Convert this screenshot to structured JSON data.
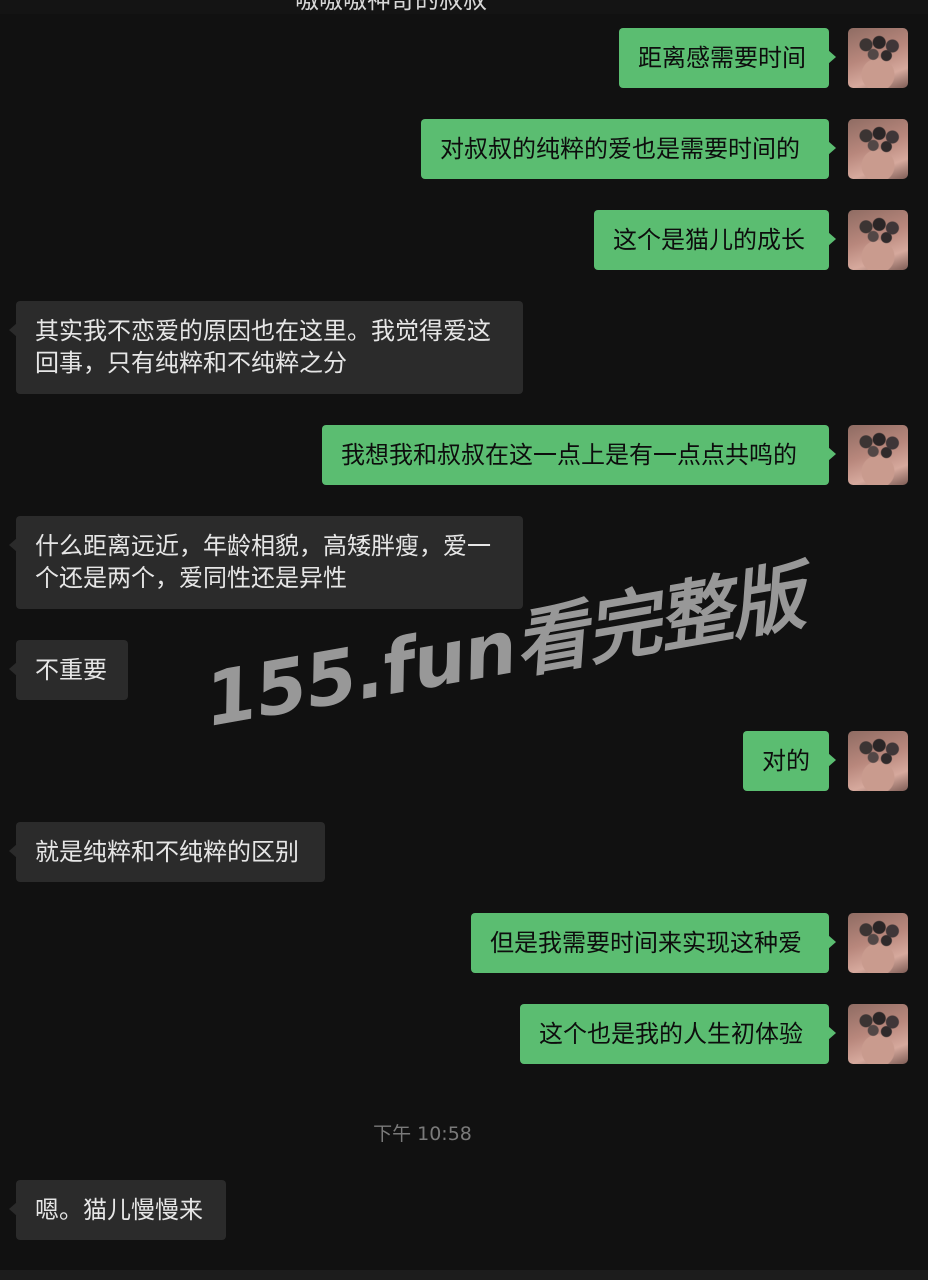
{
  "header": {
    "title": "嗷嗷嗷神奇的叔叔"
  },
  "messages": [
    {
      "side": "out",
      "text": "距离感需要时间"
    },
    {
      "side": "out",
      "text": "对叔叔的纯粹的爱也是需要时间的"
    },
    {
      "side": "out",
      "text": "这个是猫儿的成长"
    },
    {
      "side": "in",
      "text": "其实我不恋爱的原因也在这里。我觉得爱这回事，只有纯粹和不纯粹之分"
    },
    {
      "side": "out",
      "text": "我想我和叔叔在这一点上是有一点点共鸣的"
    },
    {
      "side": "in",
      "text": "什么距离远近，年龄相貌，高矮胖瘦，爱一个还是两个，爱同性还是异性"
    },
    {
      "side": "in",
      "text": "不重要"
    },
    {
      "side": "out",
      "text": "对的"
    },
    {
      "side": "in",
      "text": "就是纯粹和不纯粹的区别"
    },
    {
      "side": "out",
      "text": "但是我需要时间来实现这种爱"
    },
    {
      "side": "out",
      "text": "这个也是我的人生初体验"
    },
    {
      "side": "time",
      "text": "下午 10:58"
    },
    {
      "side": "in",
      "text": "嗯。猫儿慢慢来"
    }
  ],
  "watermark": {
    "text": "155.fun看完整版"
  },
  "colors": {
    "background": "#111111",
    "outgoing_bubble": "#5bbd71",
    "incoming_bubble": "#2b2b2b",
    "incoming_text": "#e6e6e6",
    "time_text": "#7a7a7a"
  },
  "icons": {
    "avatar": "avatar-image"
  }
}
